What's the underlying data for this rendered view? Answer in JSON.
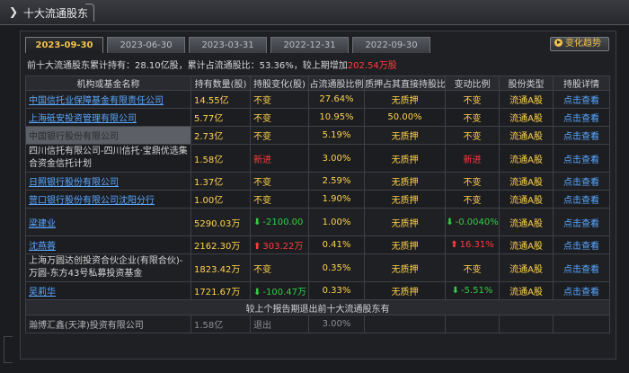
{
  "window": {
    "title": "十大流通股东"
  },
  "tabs": [
    {
      "label": "2023-09-30",
      "active": true
    },
    {
      "label": "2023-06-30",
      "active": false
    },
    {
      "label": "2023-03-31",
      "active": false
    },
    {
      "label": "2022-12-31",
      "active": false
    },
    {
      "label": "2022-09-30",
      "active": false
    }
  ],
  "trend_button": {
    "label": "变化趋势",
    "icon": "play-circle-icon"
  },
  "summary": {
    "prefix": "前十大流通股东累计持有：",
    "holding": "28.10亿股",
    "sep1": "，累计占流通股比：",
    "ratio": "53.36%",
    "sep2": "，较上期增加",
    "increase": "202.54万股"
  },
  "table": {
    "headers": [
      "机构或基金名称",
      "持有数量(股)",
      "持股变化(股)",
      "占流通股比例",
      "质押占其直接持股比",
      "变动比例",
      "股份类型",
      "持股详情"
    ],
    "rows": [
      {
        "name": "中国信托业保障基金有限责任公司",
        "qty": "14.55亿",
        "change": "不变",
        "ratio": "27.64%",
        "pledge": "无质押",
        "vary": "不变",
        "type": "流通A股",
        "detail": "点击查看"
      },
      {
        "name": "上海砥安投资管理有限公司",
        "qty": "5.77亿",
        "change": "不变",
        "ratio": "10.95%",
        "pledge": "50.00%",
        "vary": "不变",
        "type": "流通A股",
        "detail": "点击查看"
      },
      {
        "name": "中国银行股份有限公司",
        "qty": "2.73亿",
        "change": "不变",
        "ratio": "5.19%",
        "pledge": "无质押",
        "vary": "不变",
        "type": "流通A股",
        "detail": "点击查看"
      },
      {
        "name": "四川信托有限公司-四川信托·宝鼎优选集合资金信托计划",
        "qty": "1.58亿",
        "change": "新进",
        "ratio": "3.00%",
        "pledge": "无质押",
        "vary": "新进",
        "type": "流通A股",
        "detail": "点击查看"
      },
      {
        "name": "日照银行股份有限公司",
        "qty": "1.37亿",
        "change": "不变",
        "ratio": "2.59%",
        "pledge": "无质押",
        "vary": "不变",
        "type": "流通A股",
        "detail": "点击查看"
      },
      {
        "name": "营口银行股份有限公司沈阳分行",
        "qty": "1.00亿",
        "change": "不变",
        "ratio": "1.90%",
        "pledge": "无质押",
        "vary": "不变",
        "type": "流通A股",
        "detail": "点击查看"
      },
      {
        "name": "梁建业",
        "qty": "5290.03万",
        "change": "-2100.00",
        "ratio": "1.00%",
        "pledge": "无质押",
        "vary": "-0.0040%",
        "type": "流通A股",
        "detail": "点击查看"
      },
      {
        "name": "沈燕蓉",
        "qty": "2162.30万",
        "change": "303.22万",
        "ratio": "0.41%",
        "pledge": "无质押",
        "vary": "16.31%",
        "type": "流通A股",
        "detail": "点击查看"
      },
      {
        "name": "上海万圆达创投资合伙企业(有限合伙)-万圆-东方43号私募投资基金",
        "qty": "1823.42万",
        "change": "不变",
        "ratio": "0.35%",
        "pledge": "无质押",
        "vary": "不变",
        "type": "流通A股",
        "detail": "点击查看"
      },
      {
        "name": "吴莉华",
        "qty": "1721.67万",
        "change": "-100.47万",
        "ratio": "0.33%",
        "pledge": "无质押",
        "vary": "-5.51%",
        "type": "流通A股",
        "detail": "点击查看"
      }
    ],
    "exit_header": "较上个报告期退出前十大流通股东有",
    "exit_rows": [
      {
        "name": "瀚博汇鑫(天津)投资有限公司",
        "qty": "1.58亿",
        "change": "退出",
        "ratio": "3.00%"
      }
    ]
  },
  "colors": {
    "accent": "#f3c24a",
    "link": "#5aa8ff",
    "up": "#ff3b3b",
    "down": "#33cc44",
    "value": "#ffd34a"
  }
}
